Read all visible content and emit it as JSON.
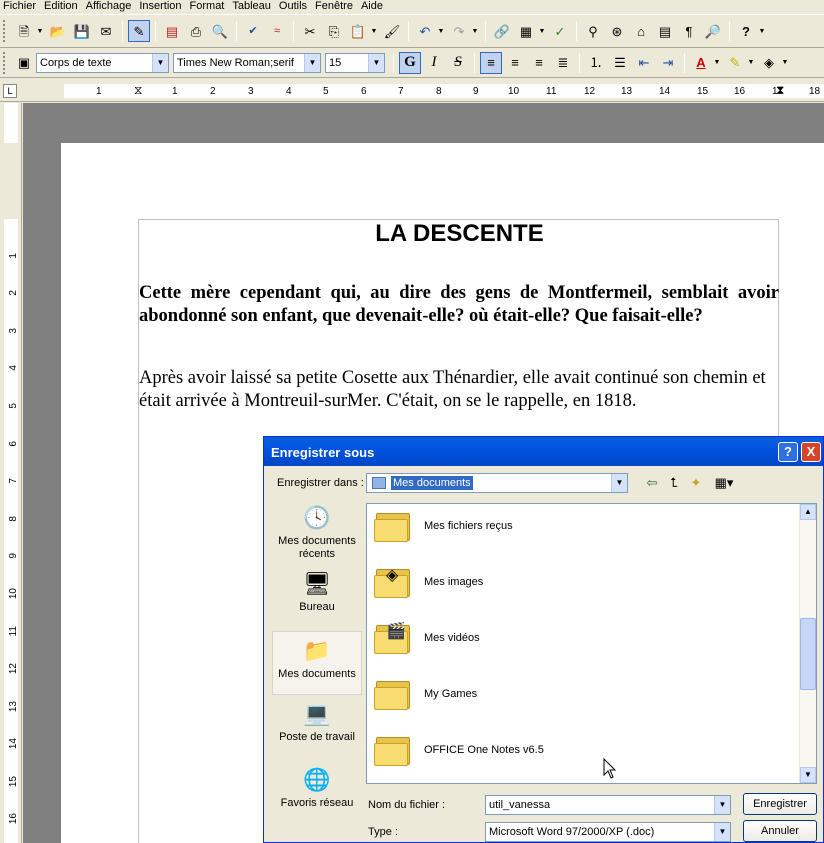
{
  "menu": [
    "Fichier",
    "Edition",
    "Affichage",
    "Insertion",
    "Format",
    "Tableau",
    "Outils",
    "Fenêtre",
    "Aide"
  ],
  "format_bar": {
    "style": "Corps de texte",
    "font": "Times New Roman;serif",
    "size": "15",
    "bold": "G",
    "italic": "I",
    "strike": "S"
  },
  "ruler": {
    "h_labels": [
      "1",
      "1",
      "2",
      "3",
      "4",
      "5",
      "6",
      "7",
      "8",
      "9",
      "10",
      "11",
      "12",
      "13",
      "14",
      "15",
      "16",
      "17",
      "18"
    ],
    "v_labels": [
      "1",
      "1",
      "2",
      "3",
      "4",
      "5",
      "6",
      "7",
      "8",
      "9",
      "10",
      "11",
      "12",
      "13",
      "14",
      "15",
      "16"
    ]
  },
  "document": {
    "title": "LA DESCENTE",
    "para1": "Cette mère cependant qui, au dire des gens de Montfermeil, semblait avoir abondonné son enfant, que devenait-elle? où était-elle? Que faisait-elle?",
    "para2": "Après avoir laissé sa petite Cosette aux Thénardier, elle avait continué son chemin et était arrivée à Montreuil-surMer. C'était, on se le rappelle, en 1818."
  },
  "dialog": {
    "title": "Enregistrer sous",
    "help": "?",
    "close": "X",
    "save_in_label": "Enregistrer dans :",
    "save_in_value": "Mes documents",
    "places": [
      "Mes documents récents",
      "Bureau",
      "Mes documents",
      "Poste de travail",
      "Favoris réseau"
    ],
    "files": [
      "Mes fichiers reçus",
      "Mes images",
      "Mes vidéos",
      "My Games",
      "OFFICE One Notes v6.5"
    ],
    "filename_label": "Nom du fichier :",
    "filename_value": "util_vanessa",
    "type_label": "Type :",
    "type_value": "Microsoft Word 97/2000/XP (.doc)",
    "save_button": "Enregistrer",
    "cancel_button": "Annuler"
  },
  "colors": {
    "titlebar": "#0054e3",
    "close": "#d8442a",
    "selection": "#316ac5",
    "canvas": "#808080"
  }
}
